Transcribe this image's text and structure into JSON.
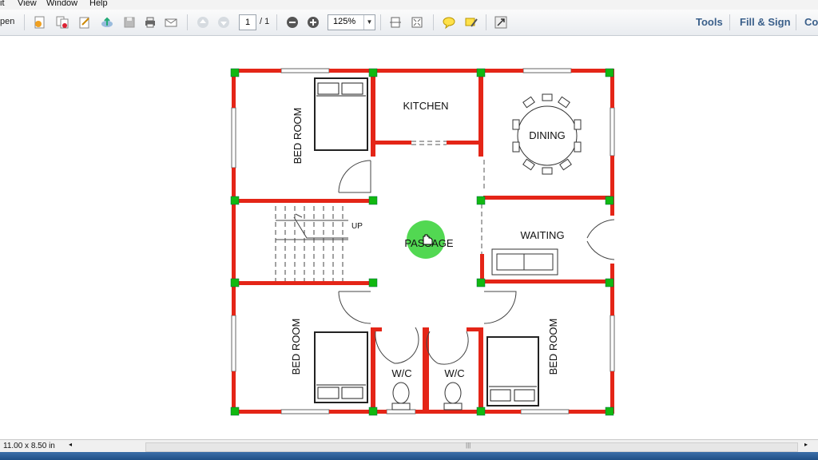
{
  "menu": {
    "items": [
      "it",
      "View",
      "Window",
      "Help"
    ]
  },
  "toolbar": {
    "open_label": "pen",
    "page_current": "1",
    "page_total": "/ 1",
    "zoom": "125%",
    "tools_label": "Tools",
    "fill_sign_label": "Fill & Sign",
    "comment_label": "Co"
  },
  "plan": {
    "rooms": {
      "bedroom_top": "BED ROOM",
      "kitchen": "KITCHEN",
      "dining": "DINING",
      "up": "UP",
      "passage": "PASSAGE",
      "waiting": "WAITING",
      "bedroom_bottom_left": "BED ROOM",
      "wc_left": "W/C",
      "wc_right": "W/C",
      "bedroom_bottom_right": "BED ROOM"
    },
    "colors": {
      "wall": "#e42517",
      "column": "#11b811",
      "cursor_highlight": "#3fd43f"
    }
  },
  "status": {
    "page_size": "11.00 x 8.50 in"
  }
}
